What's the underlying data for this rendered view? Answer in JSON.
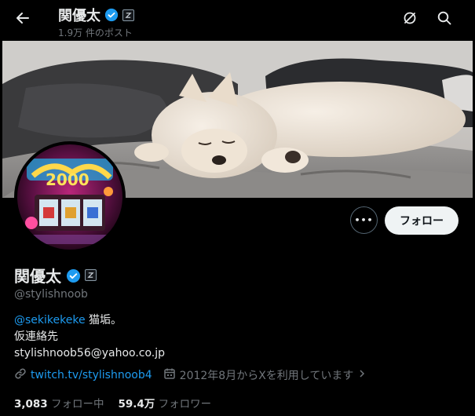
{
  "header": {
    "name": "関優太",
    "post_count": "1.9万 件のポスト",
    "icons": [
      "back-arrow-icon",
      "verified-badge-icon",
      "affiliation-badge-icon",
      "grok-icon",
      "search-icon"
    ]
  },
  "profile": {
    "name": "関優太",
    "handle": "@stylishnoob",
    "bio_mention": "@sekikekeke",
    "bio_mention_suffix": " 猫垢。",
    "bio_line2": "仮連絡先",
    "bio_line3": "stylishnoob56@yahoo.co.jp",
    "link": "twitch.tv/stylishnoob4",
    "joined": "2012年8月からXを利用しています",
    "following_count": "3,083",
    "following_label": "フォロー中",
    "followers_count": "59.4万",
    "followers_label": "フォロワー"
  },
  "actions": {
    "more_label": "•••",
    "follow_label": "フォロー"
  },
  "colors": {
    "background": "#000000",
    "accent": "#1d9bf0",
    "muted": "#71767b",
    "text": "#e7e9ea"
  }
}
